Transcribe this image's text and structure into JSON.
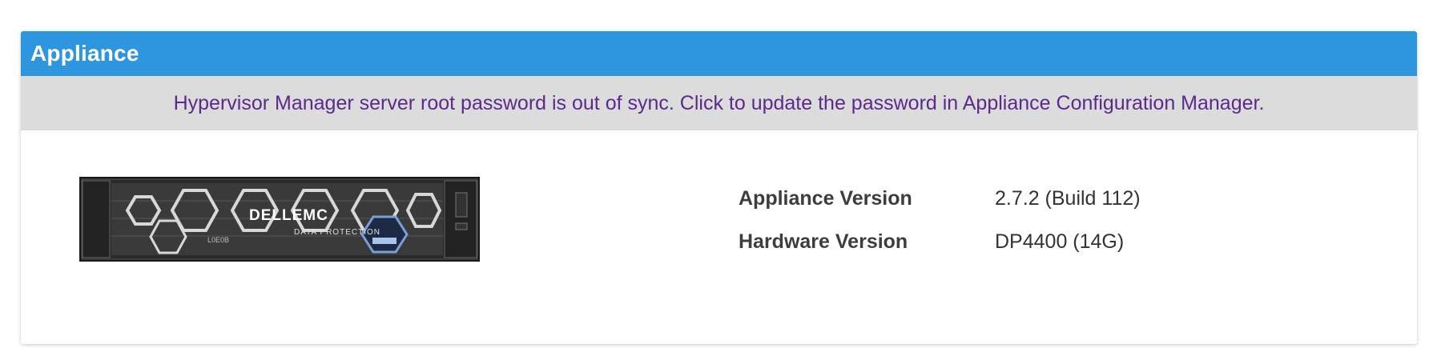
{
  "panel": {
    "title": "Appliance",
    "header_color": "#2e96de"
  },
  "banner": {
    "message": "Hypervisor Manager server root password is out of sync. Click to update the password in Appliance Configuration Manager.",
    "text_color": "#5b2a8c",
    "background": "#dcdcdc"
  },
  "appliance_image": {
    "description_icon": "server-appliance-image",
    "brand_text": "DƖLLEMC",
    "sub_text": "DATA PROTECTION"
  },
  "info": {
    "rows": [
      {
        "label": "Appliance Version",
        "value": "2.7.2 (Build 112)"
      },
      {
        "label": "Hardware Version",
        "value": "DP4400 (14G)"
      }
    ]
  }
}
